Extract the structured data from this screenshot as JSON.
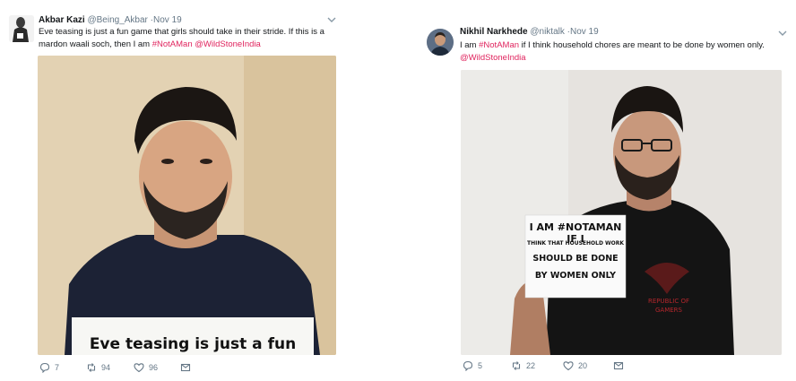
{
  "tweets": [
    {
      "author": {
        "name": "Akbar Kazi",
        "handle": "@Being_Akbar"
      },
      "date": "Nov 19",
      "text_before": "Eve teasing is just a fun game that girls should take in their stride. If this is a mardon waali soch, then I am ",
      "hashtag": "#NotAMan",
      "space": " ",
      "mention": "@WildStoneIndia",
      "photo": {
        "sign_lines": [
          "Eve teasing is just a fun game"
        ]
      },
      "actions": {
        "replies": "7",
        "retweets": "94",
        "likes": "96"
      }
    },
    {
      "author": {
        "name": "Nikhil Narkhede",
        "handle": "@niktalk"
      },
      "date": "Nov 19",
      "text_before": "I am ",
      "hashtag": "#NotAMan",
      "text_after": " if I think household chores are meant to be done by women only.",
      "mention": "@WildStoneIndia",
      "photo": {
        "sign_lines": [
          "I AM #NOTAMAN IF I",
          "THINK THAT HOUSEHOLD WORK",
          "SHOULD BE DONE",
          "BY WOMEN ONLY"
        ],
        "shirt_text": [
          "REPUBLIC OF",
          "GAMERS"
        ]
      },
      "actions": {
        "replies": "5",
        "retweets": "22",
        "likes": "20"
      }
    }
  ],
  "ui": {
    "dot": "·"
  },
  "colors": {
    "link": "#e0245e",
    "meta": "#657786",
    "text": "#14171a"
  },
  "icons": [
    "reply-icon",
    "retweet-icon",
    "like-icon",
    "message-icon",
    "chevron-down-icon"
  ]
}
